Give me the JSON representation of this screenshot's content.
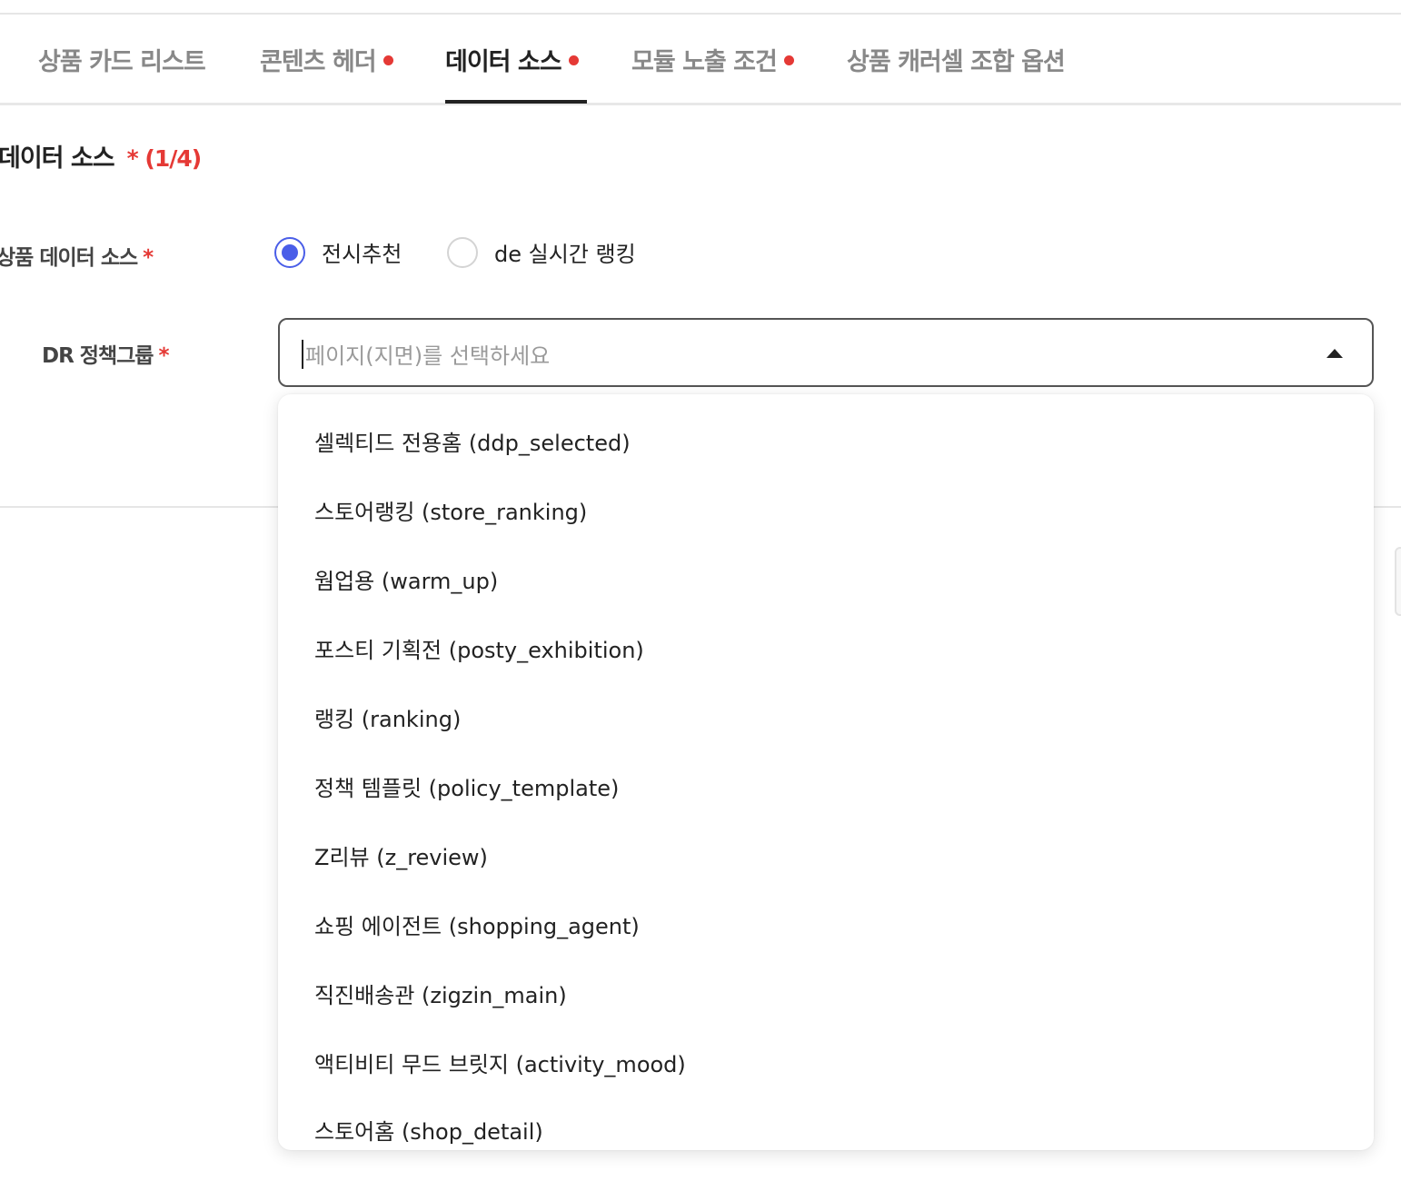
{
  "tabs": [
    {
      "label": "상품 카드 리스트",
      "dot": false,
      "active": false
    },
    {
      "label": "콘텐츠 헤더",
      "dot": true,
      "active": false
    },
    {
      "label": "데이터 소스",
      "dot": true,
      "active": true
    },
    {
      "label": "모듈 노출 조건",
      "dot": true,
      "active": false
    },
    {
      "label": "상품 캐러셀 조합 옵션",
      "dot": false,
      "active": false
    }
  ],
  "section": {
    "title": "데이터 소스",
    "required_mark": "* (1/4)"
  },
  "product_data_source": {
    "label": "상품 데이터 소스",
    "star": "*",
    "options": [
      {
        "label": "전시추천",
        "checked": true
      },
      {
        "label": "de 실시간 랭킹",
        "checked": false
      }
    ]
  },
  "dr_policy_group": {
    "label": "DR 정책그룹",
    "star": "*",
    "placeholder": "페이지(지면)를 선택하세요"
  },
  "dropdown_options": [
    "셀렉티드 전용홈 (ddp_selected)",
    "스토어랭킹 (store_ranking)",
    "웜업용 (warm_up)",
    "포스티 기획전 (posty_exhibition)",
    "랭킹 (ranking)",
    "정책 템플릿 (policy_template)",
    "Z리뷰 (z_review)",
    "쇼핑 에이전트 (shopping_agent)",
    "직진배송관 (zigzin_main)",
    "액티비티 무드 브릿지 (activity_mood)",
    "스토어홈 (shop_detail)"
  ],
  "colors": {
    "accent": "#4a5ee8",
    "required": "#e53935",
    "active_tab": "#222222",
    "inactive_tab": "#888888"
  }
}
